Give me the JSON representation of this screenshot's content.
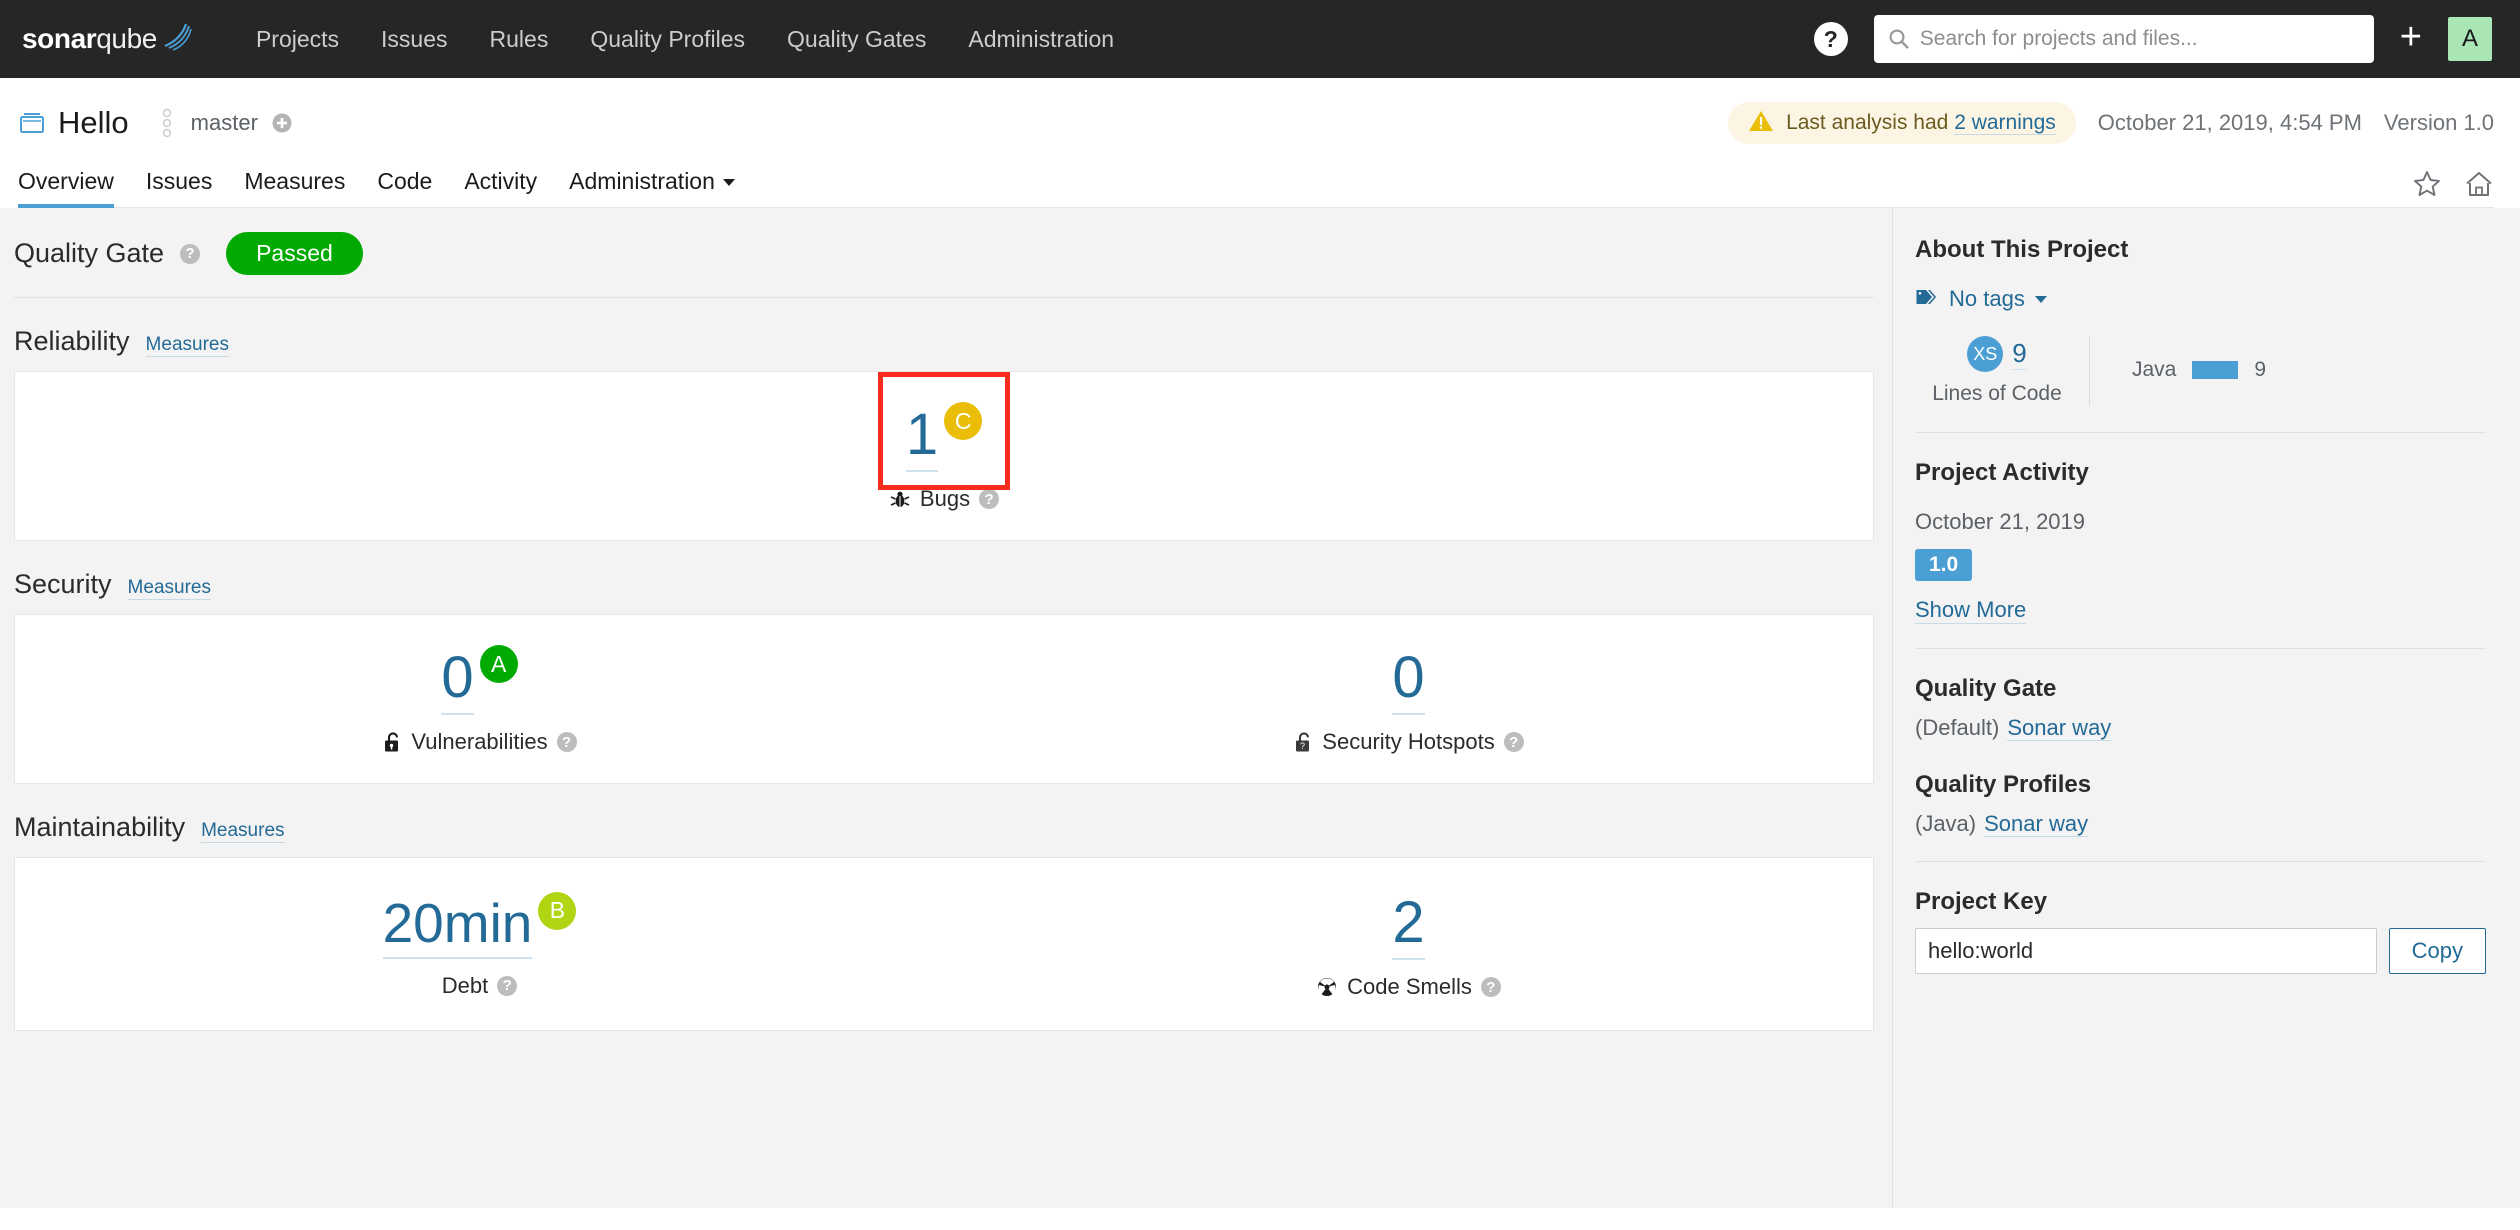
{
  "topnav": {
    "logo": {
      "bold_part": "sonar",
      "light_part": "qube",
      "icon": "sonarqube-logo-icon"
    },
    "links": [
      {
        "label": "Projects"
      },
      {
        "label": "Issues"
      },
      {
        "label": "Rules"
      },
      {
        "label": "Quality Profiles"
      },
      {
        "label": "Quality Gates"
      },
      {
        "label": "Administration"
      }
    ],
    "help_icon_label": "?",
    "search": {
      "placeholder": "Search for projects and files...",
      "value": ""
    },
    "plus_label": "+",
    "avatar_initial": "A",
    "background": "#262626"
  },
  "project_header": {
    "icon": "project-icon",
    "title": "Hello",
    "branch": "master",
    "branch_add_icon": "plus-circle-icon",
    "warning": {
      "icon": "warning-triangle-icon",
      "prefix": "Last analysis had",
      "link": "2 warnings"
    },
    "analysis_date": "October 21, 2019, 4:54 PM",
    "version": "Version 1.0",
    "tabs": [
      {
        "label": "Overview",
        "active": true
      },
      {
        "label": "Issues",
        "active": false
      },
      {
        "label": "Measures",
        "active": false
      },
      {
        "label": "Code",
        "active": false
      },
      {
        "label": "Activity",
        "active": false
      },
      {
        "label": "Administration",
        "active": false,
        "has_caret": true
      }
    ],
    "icons": [
      {
        "name": "favorite-star-icon"
      },
      {
        "name": "home-icon"
      }
    ]
  },
  "overview": {
    "quality_gate": {
      "title": "Quality Gate",
      "help": "?",
      "status": "Passed",
      "status_color": "#00aa00"
    },
    "sections": [
      {
        "title": "Reliability",
        "link": "Measures",
        "measures": [
          {
            "value": "1",
            "label": "Bugs",
            "icon": "bug-icon",
            "rating": "C",
            "rating_color": "#eabe06",
            "help": "?",
            "highlighted": true
          }
        ]
      },
      {
        "title": "Security",
        "link": "Measures",
        "measures": [
          {
            "value": "0",
            "label": "Vulnerabilities",
            "icon": "open-lock-icon",
            "rating": "A",
            "rating_color": "#00aa00",
            "help": "?",
            "highlighted": false
          },
          {
            "value": "0",
            "label": "Security Hotspots",
            "icon": "security-hotspot-icon",
            "rating": "",
            "rating_color": "",
            "help": "?",
            "highlighted": false
          }
        ]
      },
      {
        "title": "Maintainability",
        "link": "Measures",
        "measures": [
          {
            "value": "20min",
            "label": "Debt",
            "icon": "",
            "rating": "B",
            "rating_color": "#b0d513",
            "help": "?",
            "highlighted": false
          },
          {
            "value": "2",
            "label": "Code Smells",
            "icon": "code-smell-icon",
            "rating": "",
            "rating_color": "",
            "help": "?",
            "highlighted": false
          }
        ]
      }
    ]
  },
  "sidebar": {
    "about_title": "About This Project",
    "tags": {
      "icon": "tag-icon",
      "label": "No tags"
    },
    "size_rating": "XS",
    "lines_of_code": "9",
    "lines_of_code_caption": "Lines of Code",
    "languages": [
      {
        "name": "Java",
        "value": "9",
        "color": "#4b9fd5"
      }
    ],
    "activity_title": "Project Activity",
    "activity_date": "October 21, 2019",
    "activity_version": "1.0",
    "show_more": "Show More",
    "quality_gate_title": "Quality Gate",
    "quality_gate_default": "(Default)",
    "quality_gate_name": "Sonar way",
    "quality_profiles_title": "Quality Profiles",
    "quality_profiles_lang": "(Java)",
    "quality_profiles_name": "Sonar way",
    "project_key_title": "Project Key",
    "project_key_value": "hello:world",
    "copy_label": "Copy"
  }
}
